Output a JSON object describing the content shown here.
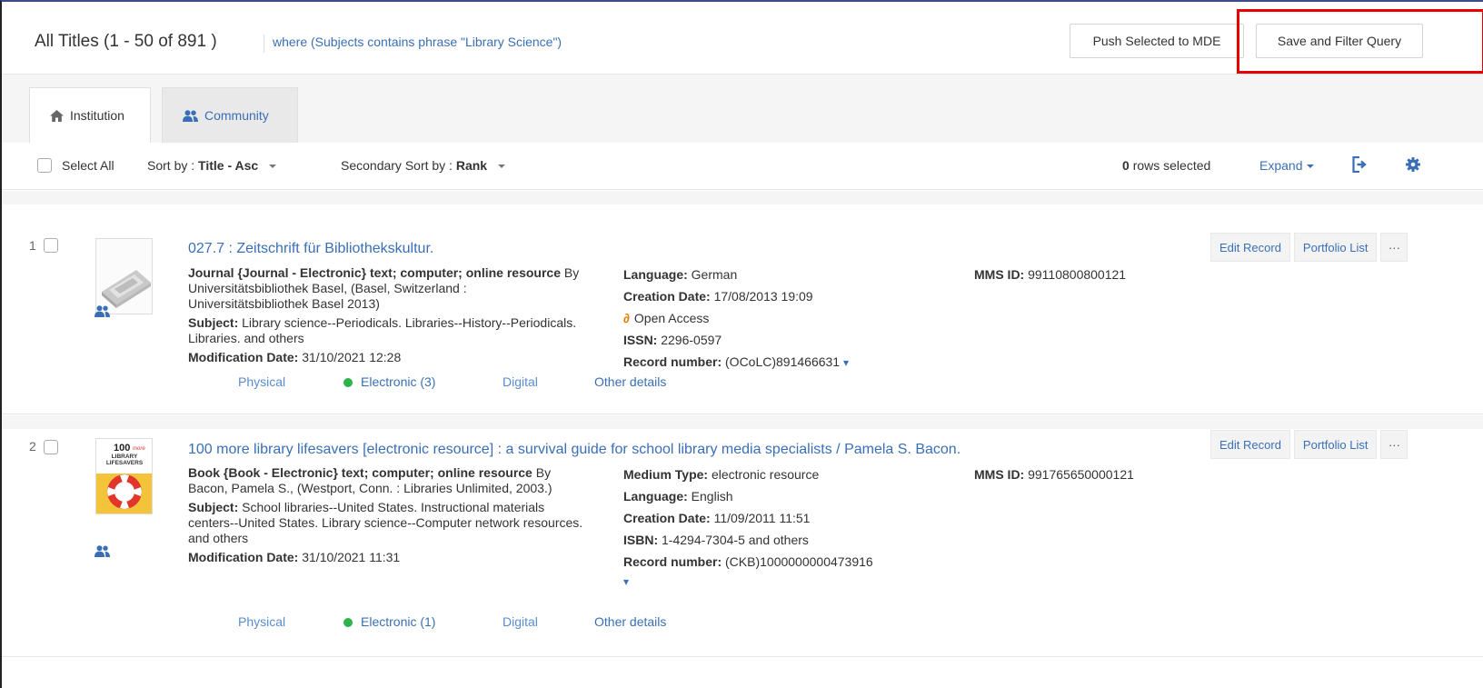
{
  "header": {
    "title": "All Titles (1 - 50 of 891 )",
    "query": "where (Subjects contains phrase \"Library Science\")",
    "push_button": "Push Selected to MDE",
    "save_button": "Save and Filter Query"
  },
  "tabs": [
    {
      "label": "Institution",
      "icon": "home-icon",
      "active": true
    },
    {
      "label": "Community",
      "icon": "users-icon",
      "active": false
    }
  ],
  "toolbar": {
    "select_all": "Select All",
    "sort_label": "Sort by :",
    "sort_value": "Title - Asc",
    "secondary_label": "Secondary Sort by :",
    "secondary_value": "Rank",
    "rows_count": "0",
    "rows_label": "rows selected",
    "expand": "Expand"
  },
  "records": [
    {
      "number": "1",
      "title": "027.7 : Zeitschrift für Bibliothekskultur.",
      "type": "Journal {Journal - Electronic} text; computer; online resource",
      "by": "By Universitätsbibliothek Basel, (Basel, Switzerland : Universitätsbibliothek Basel 2013)",
      "subject_label": "Subject:",
      "subject": "Library science--Periodicals. Libraries--History--Periodicals. Libraries. and others",
      "modification_label": "Modification Date:",
      "modification": "31/10/2021 12:28",
      "language_label": "Language:",
      "language": "German",
      "creation_label": "Creation Date:",
      "creation": "17/08/2013 19:09",
      "open_access": "Open Access",
      "issn_label": "ISSN:",
      "issn": "2296-0597",
      "record_label": "Record number:",
      "record": "(OCoLC)891466631",
      "mms_label": "MMS ID:",
      "mms": "99110800800121",
      "links": {
        "physical": "Physical",
        "electronic": "Electronic (3)",
        "digital": "Digital",
        "other": "Other details"
      },
      "buttons": {
        "edit": "Edit Record",
        "portfolio": "Portfolio List",
        "more": "···"
      }
    },
    {
      "number": "2",
      "title": "100 more library lifesavers [electronic resource] : a survival guide for school library media specialists / Pamela S. Bacon.",
      "type": "Book {Book - Electronic} text; computer; online resource",
      "by": "By Bacon, Pamela S., (Westport, Conn. : Libraries Unlimited, 2003.)",
      "subject_label": "Subject:",
      "subject": "School libraries--United States. Instructional materials centers--United States. Library science--Computer network resources. and others",
      "modification_label": "Modification Date:",
      "modification": "31/10/2021 11:31",
      "medium_label": "Medium Type:",
      "medium": "electronic resource",
      "language_label": "Language:",
      "language": "English",
      "creation_label": "Creation Date:",
      "creation": "11/09/2011 11:51",
      "isbn_label": "ISBN:",
      "isbn": "1-4294-7304-5 and others",
      "record_label": "Record number:",
      "record": "(CKB)1000000000473916",
      "mms_label": "MMS ID:",
      "mms": "991765650000121",
      "cover_text": {
        "number": "100",
        "more": "more",
        "line1": "LIBRARY",
        "line2": "LIFESAVERS"
      },
      "links": {
        "physical": "Physical",
        "electronic": "Electronic (1)",
        "digital": "Digital",
        "other": "Other details"
      },
      "buttons": {
        "edit": "Edit Record",
        "portfolio": "Portfolio List",
        "more": "···"
      }
    }
  ],
  "icons": {
    "home": "home-icon",
    "users": "users-icon",
    "export": "export-icon",
    "settings": "gear-icon",
    "open_access": "open-access-icon",
    "show_more": "double-chevron-down-icon"
  },
  "colors": {
    "link": "#3a6fb7",
    "highlight": "#e60000",
    "electronic_dot": "#2db34a",
    "open_access": "#e37b00"
  }
}
